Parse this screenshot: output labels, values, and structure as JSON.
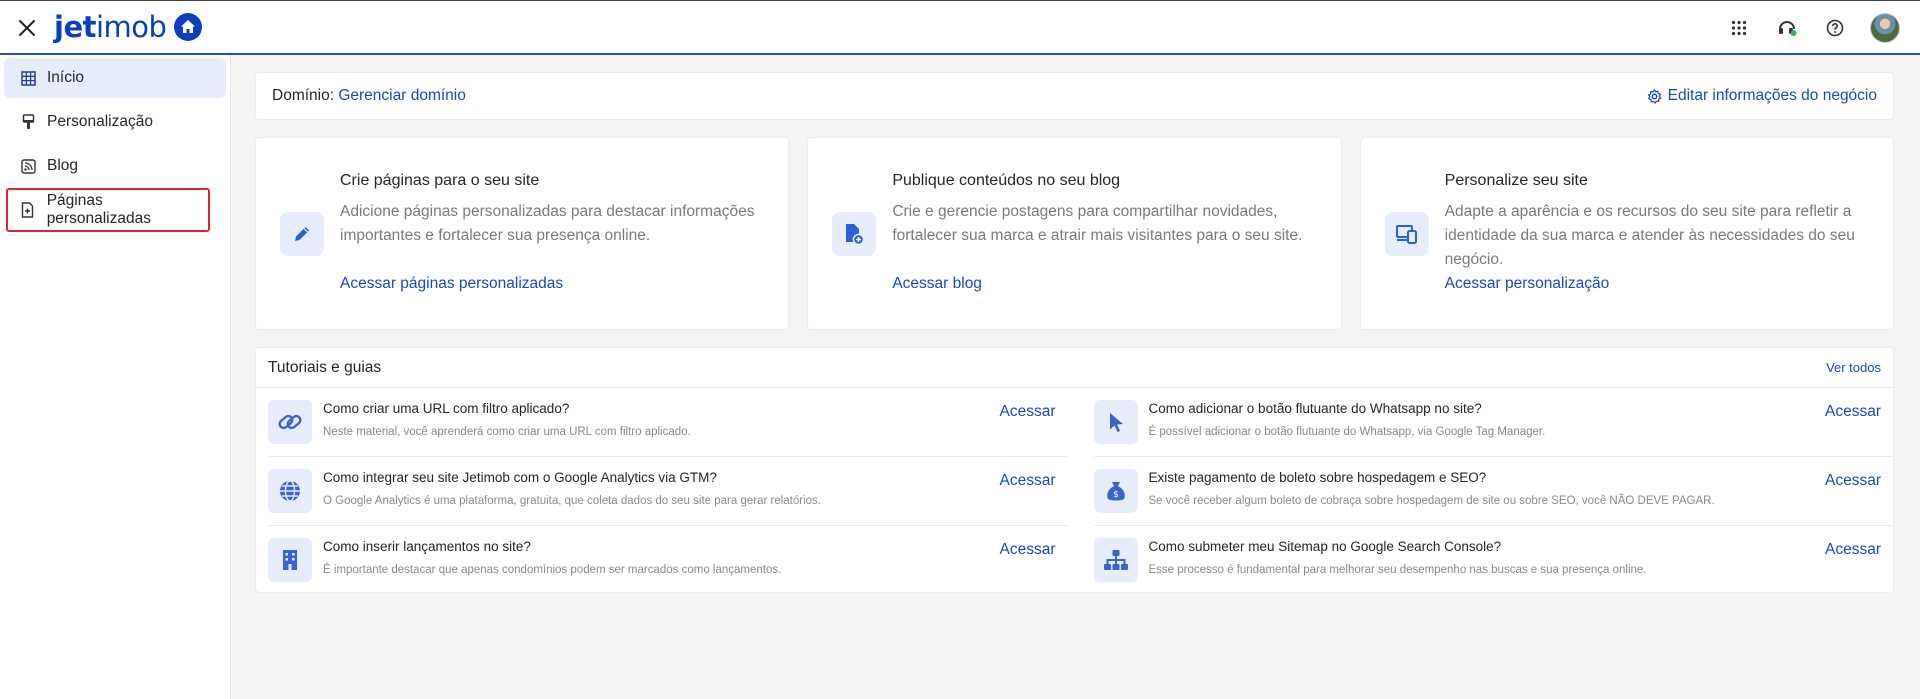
{
  "header": {
    "logo_text_bold": "jet",
    "logo_text_light": "imob",
    "brand_color": "#0b3fbf",
    "icons": [
      "close-icon",
      "apps-grid-icon",
      "support-headset-icon",
      "help-icon",
      "avatar"
    ]
  },
  "sidebar": {
    "items": [
      {
        "label": "Início",
        "icon": "grid-table-icon",
        "active": true
      },
      {
        "label": "Personalização",
        "icon": "paint-brush-icon"
      },
      {
        "label": "Blog",
        "icon": "rss-icon"
      },
      {
        "label": "Páginas personalizadas",
        "icon": "add-page-icon",
        "highlighted": true
      }
    ]
  },
  "domain": {
    "label": "Domínio:",
    "link": "Gerenciar domínio",
    "edit_link": "Editar informações do negócio"
  },
  "cards": [
    {
      "title": "Crie páginas para o seu site",
      "description": "Adicione páginas personalizadas para destacar informações importantes e fortalecer sua presença online.",
      "link": "Acessar páginas personalizadas",
      "icon": "pencil-icon"
    },
    {
      "title": "Publique conteúdos no seu blog",
      "description": "Crie e gerencie postagens para compartilhar novidades, fortalecer sua marca e atrair mais visitantes para o seu site.",
      "link": "Acessar blog",
      "icon": "new-document-icon"
    },
    {
      "title": "Personalize seu site",
      "description": "Adapte a aparência e os recursos do seu site para refletir a identidade da sua marca e atender às necessidades do seu negócio.",
      "link": "Acessar personalização",
      "icon": "devices-icon"
    }
  ],
  "tutorials": {
    "title": "Tutoriais e guias",
    "see_all": "Ver todos",
    "items": [
      {
        "q": "Como criar uma URL com filtro aplicado?",
        "a": "Neste material, você aprenderá como criar uma URL com filtro aplicado.",
        "cta": "Acessar",
        "icon": "link-icon"
      },
      {
        "q": "Como adicionar o botão flutuante do Whatsapp no site?",
        "a": "É possível adicionar o botão flutuante do Whatsapp, via Google Tag Manager.",
        "cta": "Acessar",
        "icon": "cursor-icon"
      },
      {
        "q": "Como integrar seu site Jetimob com o Google Analytics via GTM?",
        "a": "O Google Analytics é uma plataforma, gratuita, que coleta dados do seu site para gerar relatórios.",
        "cta": "Acessar",
        "icon": "globe-icon"
      },
      {
        "q": "Existe pagamento de boleto sobre hospedagem e SEO?",
        "a": "Se você receber algum boleto de cobraça sobre hospedagem de site ou sobre SEO, você NÃO DEVE PAGAR.",
        "cta": "Acessar",
        "icon": "money-bag-icon"
      },
      {
        "q": "Como inserir lançamentos no site?",
        "a": "É importante destacar que apenas condomínios podem ser marcados como lançamentos.",
        "cta": "Acessar",
        "icon": "building-icon"
      },
      {
        "q": "Como submeter meu Sitemap no Google Search Console?",
        "a": "Esse processo é fundamental para melhorar seu desempenho nas buscas e sua presença online.",
        "cta": "Acessar",
        "icon": "sitemap-icon"
      }
    ]
  }
}
